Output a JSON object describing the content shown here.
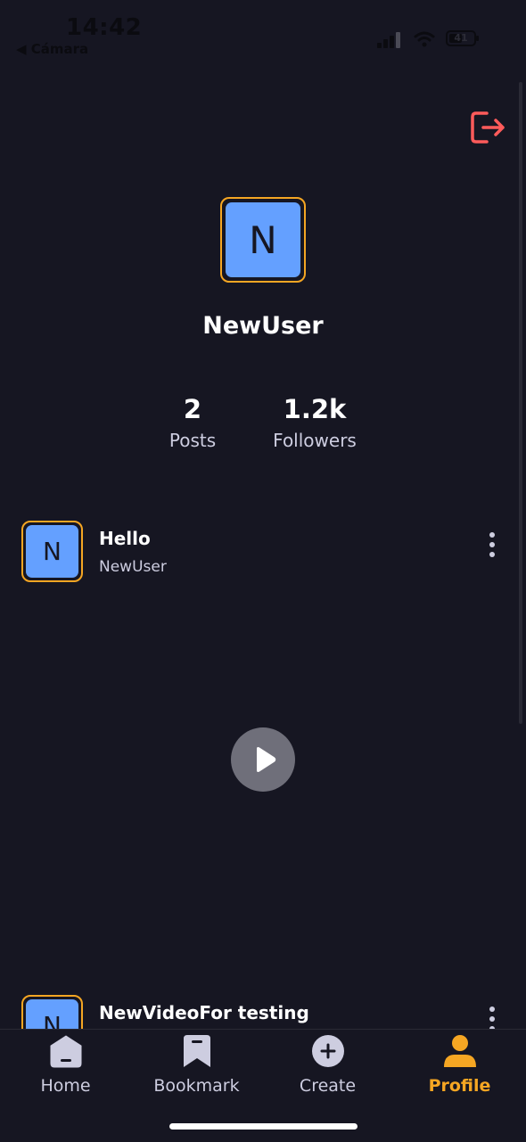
{
  "status_bar": {
    "time": "14:42",
    "back_label": "◀ Cámara",
    "battery": "41"
  },
  "profile": {
    "avatar_letter": "N",
    "username": "NewUser",
    "stats": [
      {
        "value": "2",
        "label": "Posts"
      },
      {
        "value": "1.2k",
        "label": "Followers"
      }
    ]
  },
  "posts": [
    {
      "avatar_letter": "N",
      "title": "Hello",
      "author": "NewUser"
    },
    {
      "avatar_letter": "N",
      "title": "NewVideoFor testing",
      "author": ""
    }
  ],
  "tabs": [
    {
      "label": "Home",
      "icon": "home-icon"
    },
    {
      "label": "Bookmark",
      "icon": "bookmark-icon"
    },
    {
      "label": "Create",
      "icon": "plus-circle-icon"
    },
    {
      "label": "Profile",
      "icon": "profile-icon",
      "active": true
    }
  ],
  "colors": {
    "background": "#161622",
    "accent": "#f5a623",
    "avatar": "#64a0ff",
    "logout": "#ff5b5b",
    "muted_text": "#cdcde0"
  }
}
